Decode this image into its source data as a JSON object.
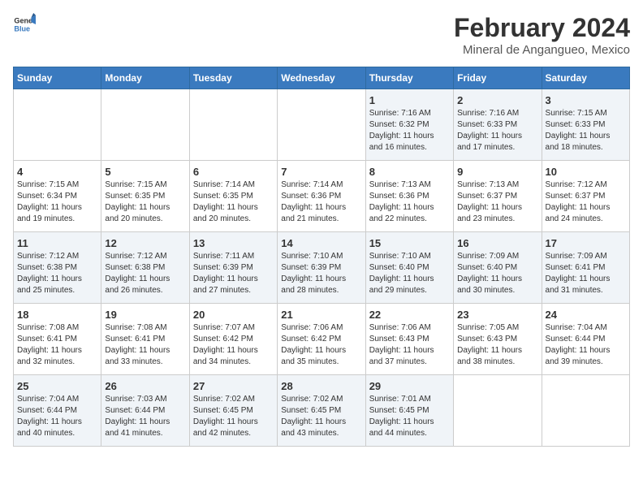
{
  "header": {
    "logo_general": "General",
    "logo_blue": "Blue",
    "title": "February 2024",
    "subtitle": "Mineral de Angangueo, Mexico"
  },
  "days_of_week": [
    "Sunday",
    "Monday",
    "Tuesday",
    "Wednesday",
    "Thursday",
    "Friday",
    "Saturday"
  ],
  "weeks": [
    [
      {
        "day": "",
        "content": ""
      },
      {
        "day": "",
        "content": ""
      },
      {
        "day": "",
        "content": ""
      },
      {
        "day": "",
        "content": ""
      },
      {
        "day": "1",
        "content": "Sunrise: 7:16 AM\nSunset: 6:32 PM\nDaylight: 11 hours\nand 16 minutes."
      },
      {
        "day": "2",
        "content": "Sunrise: 7:16 AM\nSunset: 6:33 PM\nDaylight: 11 hours\nand 17 minutes."
      },
      {
        "day": "3",
        "content": "Sunrise: 7:15 AM\nSunset: 6:33 PM\nDaylight: 11 hours\nand 18 minutes."
      }
    ],
    [
      {
        "day": "4",
        "content": "Sunrise: 7:15 AM\nSunset: 6:34 PM\nDaylight: 11 hours\nand 19 minutes."
      },
      {
        "day": "5",
        "content": "Sunrise: 7:15 AM\nSunset: 6:35 PM\nDaylight: 11 hours\nand 20 minutes."
      },
      {
        "day": "6",
        "content": "Sunrise: 7:14 AM\nSunset: 6:35 PM\nDaylight: 11 hours\nand 20 minutes."
      },
      {
        "day": "7",
        "content": "Sunrise: 7:14 AM\nSunset: 6:36 PM\nDaylight: 11 hours\nand 21 minutes."
      },
      {
        "day": "8",
        "content": "Sunrise: 7:13 AM\nSunset: 6:36 PM\nDaylight: 11 hours\nand 22 minutes."
      },
      {
        "day": "9",
        "content": "Sunrise: 7:13 AM\nSunset: 6:37 PM\nDaylight: 11 hours\nand 23 minutes."
      },
      {
        "day": "10",
        "content": "Sunrise: 7:12 AM\nSunset: 6:37 PM\nDaylight: 11 hours\nand 24 minutes."
      }
    ],
    [
      {
        "day": "11",
        "content": "Sunrise: 7:12 AM\nSunset: 6:38 PM\nDaylight: 11 hours\nand 25 minutes."
      },
      {
        "day": "12",
        "content": "Sunrise: 7:12 AM\nSunset: 6:38 PM\nDaylight: 11 hours\nand 26 minutes."
      },
      {
        "day": "13",
        "content": "Sunrise: 7:11 AM\nSunset: 6:39 PM\nDaylight: 11 hours\nand 27 minutes."
      },
      {
        "day": "14",
        "content": "Sunrise: 7:10 AM\nSunset: 6:39 PM\nDaylight: 11 hours\nand 28 minutes."
      },
      {
        "day": "15",
        "content": "Sunrise: 7:10 AM\nSunset: 6:40 PM\nDaylight: 11 hours\nand 29 minutes."
      },
      {
        "day": "16",
        "content": "Sunrise: 7:09 AM\nSunset: 6:40 PM\nDaylight: 11 hours\nand 30 minutes."
      },
      {
        "day": "17",
        "content": "Sunrise: 7:09 AM\nSunset: 6:41 PM\nDaylight: 11 hours\nand 31 minutes."
      }
    ],
    [
      {
        "day": "18",
        "content": "Sunrise: 7:08 AM\nSunset: 6:41 PM\nDaylight: 11 hours\nand 32 minutes."
      },
      {
        "day": "19",
        "content": "Sunrise: 7:08 AM\nSunset: 6:41 PM\nDaylight: 11 hours\nand 33 minutes."
      },
      {
        "day": "20",
        "content": "Sunrise: 7:07 AM\nSunset: 6:42 PM\nDaylight: 11 hours\nand 34 minutes."
      },
      {
        "day": "21",
        "content": "Sunrise: 7:06 AM\nSunset: 6:42 PM\nDaylight: 11 hours\nand 35 minutes."
      },
      {
        "day": "22",
        "content": "Sunrise: 7:06 AM\nSunset: 6:43 PM\nDaylight: 11 hours\nand 37 minutes."
      },
      {
        "day": "23",
        "content": "Sunrise: 7:05 AM\nSunset: 6:43 PM\nDaylight: 11 hours\nand 38 minutes."
      },
      {
        "day": "24",
        "content": "Sunrise: 7:04 AM\nSunset: 6:44 PM\nDaylight: 11 hours\nand 39 minutes."
      }
    ],
    [
      {
        "day": "25",
        "content": "Sunrise: 7:04 AM\nSunset: 6:44 PM\nDaylight: 11 hours\nand 40 minutes."
      },
      {
        "day": "26",
        "content": "Sunrise: 7:03 AM\nSunset: 6:44 PM\nDaylight: 11 hours\nand 41 minutes."
      },
      {
        "day": "27",
        "content": "Sunrise: 7:02 AM\nSunset: 6:45 PM\nDaylight: 11 hours\nand 42 minutes."
      },
      {
        "day": "28",
        "content": "Sunrise: 7:02 AM\nSunset: 6:45 PM\nDaylight: 11 hours\nand 43 minutes."
      },
      {
        "day": "29",
        "content": "Sunrise: 7:01 AM\nSunset: 6:45 PM\nDaylight: 11 hours\nand 44 minutes."
      },
      {
        "day": "",
        "content": ""
      },
      {
        "day": "",
        "content": ""
      }
    ]
  ]
}
